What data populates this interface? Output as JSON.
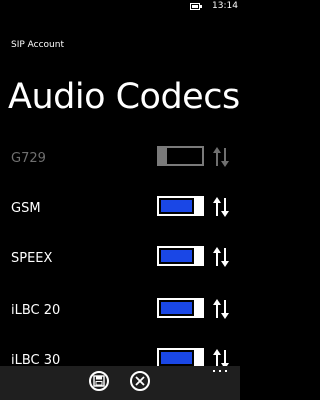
{
  "status": {
    "time": "13:14",
    "battery_icon": "battery-icon"
  },
  "app_title": "SIP Account",
  "page_title": "Audio Codecs",
  "codecs": [
    {
      "name": "G729",
      "enabled": false
    },
    {
      "name": "GSM",
      "enabled": true
    },
    {
      "name": "SPEEX",
      "enabled": true
    },
    {
      "name": "iLBC 20",
      "enabled": true
    },
    {
      "name": "iLBC 30",
      "enabled": true
    }
  ],
  "app_bar": {
    "buttons": [
      {
        "icon": "save-icon",
        "action": "save"
      },
      {
        "icon": "close-icon",
        "action": "cancel"
      }
    ],
    "more_icon": "more-icon"
  },
  "colors": {
    "toggle_on": "#1a47e6",
    "disabled_text": "#6f6f6f",
    "app_bar_bg": "#1f1f1f"
  }
}
